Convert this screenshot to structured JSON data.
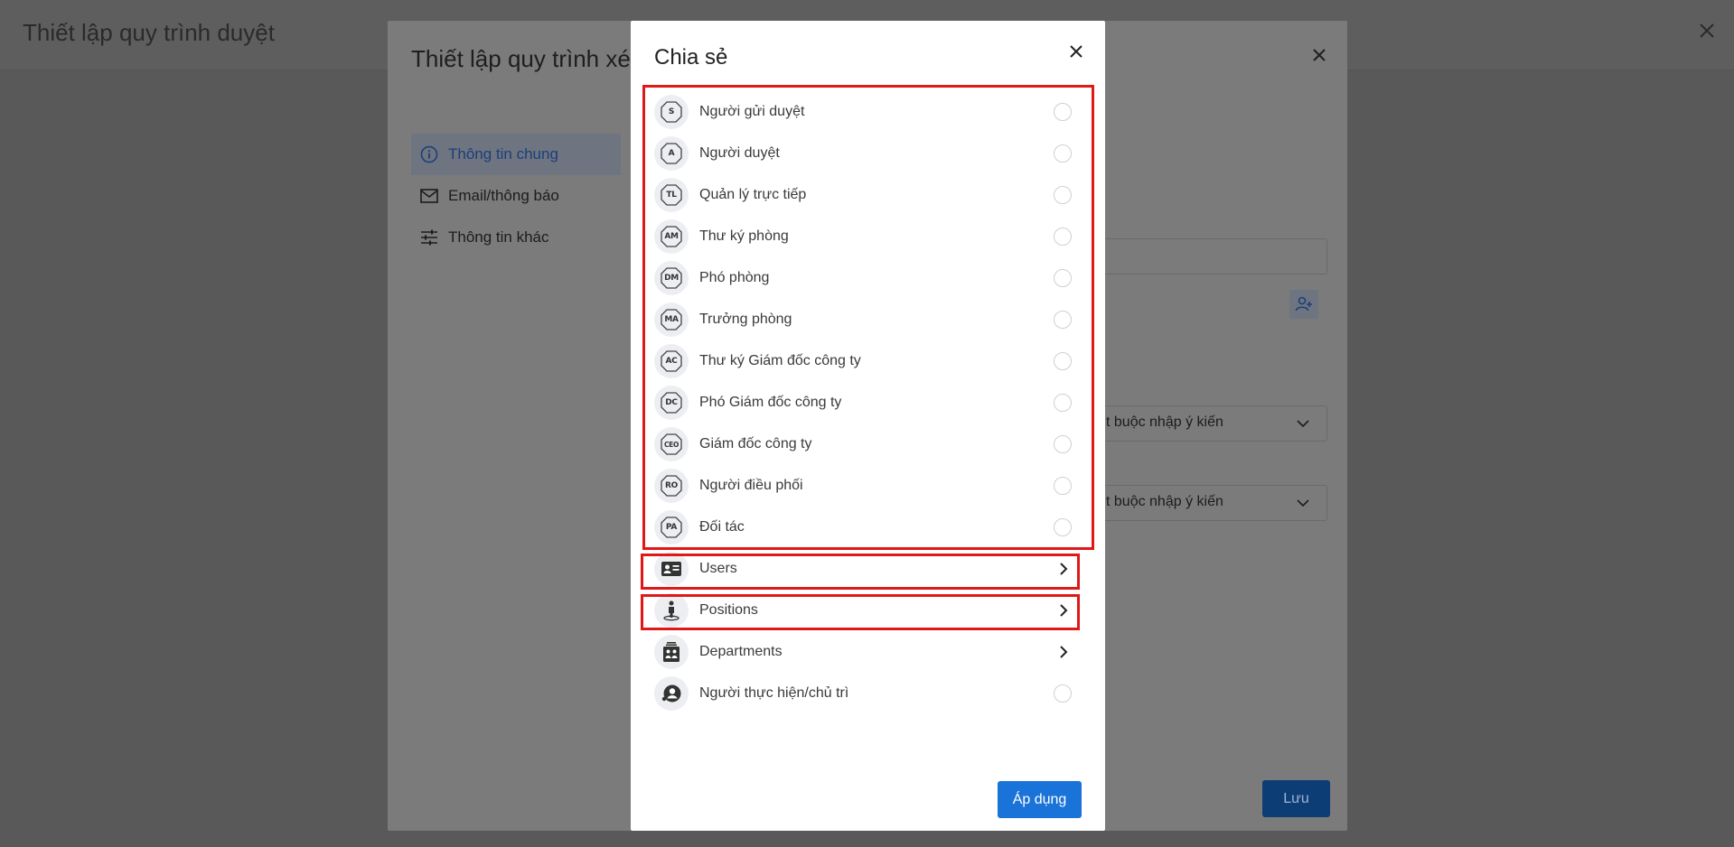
{
  "page": {
    "title": "Thiết lập quy trình duyệt"
  },
  "mid_modal": {
    "title": "Thiết lập quy trình xét",
    "nav": [
      {
        "label": "Thông tin chung",
        "icon": "info-icon",
        "active": true
      },
      {
        "label": "Email/thông báo",
        "icon": "mail-icon",
        "active": false
      },
      {
        "label": "Thông tin khác",
        "icon": "sliders-icon",
        "active": false
      }
    ],
    "select1_value": "t buộc nhập ý kiến",
    "select2_value": "t buộc nhập ý kiến",
    "save_label": "Lưu"
  },
  "share_modal": {
    "title": "Chia sẻ",
    "roles": [
      {
        "code": "S",
        "label": "Người gửi duyệt"
      },
      {
        "code": "A",
        "label": "Người duyệt"
      },
      {
        "code": "TL",
        "label": "Quản lý trực tiếp"
      },
      {
        "code": "AM",
        "label": "Thư ký phòng"
      },
      {
        "code": "DM",
        "label": "Phó phòng"
      },
      {
        "code": "MA",
        "label": "Trưởng phòng"
      },
      {
        "code": "AC",
        "label": "Thư ký Giám đốc công ty"
      },
      {
        "code": "DC",
        "label": "Phó Giám đốc công ty"
      },
      {
        "code": "CEO",
        "label": "Giám đốc công ty"
      },
      {
        "code": "RO",
        "label": "Người điều phối"
      },
      {
        "code": "PA",
        "label": "Đối tác"
      }
    ],
    "groups": [
      {
        "label": "Users",
        "icon": "id-card-icon"
      },
      {
        "label": "Positions",
        "icon": "person-position-icon"
      },
      {
        "label": "Departments",
        "icon": "building-icon"
      }
    ],
    "performer_label": "Người thực hiện/chủ trì",
    "apply_label": "Áp dụng"
  },
  "colors": {
    "highlight": "#e01818",
    "primary": "#1a73d9"
  }
}
